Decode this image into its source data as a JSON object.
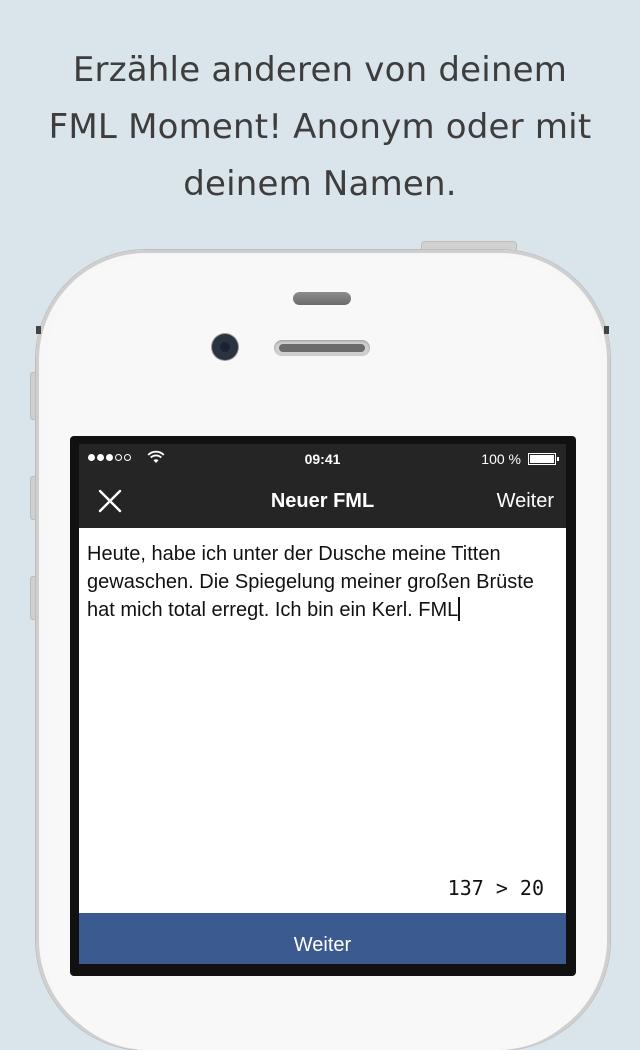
{
  "headline": {
    "line1": "Erzähle anderen von deinem",
    "line2": "FML Moment! Anonym oder mit",
    "line3": "deinem Namen."
  },
  "status_bar": {
    "time": "09:41",
    "battery": "100 %",
    "signal_bars_filled": 3,
    "signal_bars_total": 5
  },
  "nav": {
    "title": "Neuer FML",
    "next_label": "Weiter",
    "close_icon": "close-icon"
  },
  "editor": {
    "text": "Heute, habe ich unter der Dusche meine Titten gewaschen. Die Spiegelung meiner großen Brüste hat mich total erregt. Ich bin ein Kerl. FML"
  },
  "counter": "137 > 20",
  "submit_label": "Weiter",
  "colors": {
    "background": "#d9e5ea",
    "navbar": "#252525",
    "submit_button": "#3b5a8f"
  }
}
